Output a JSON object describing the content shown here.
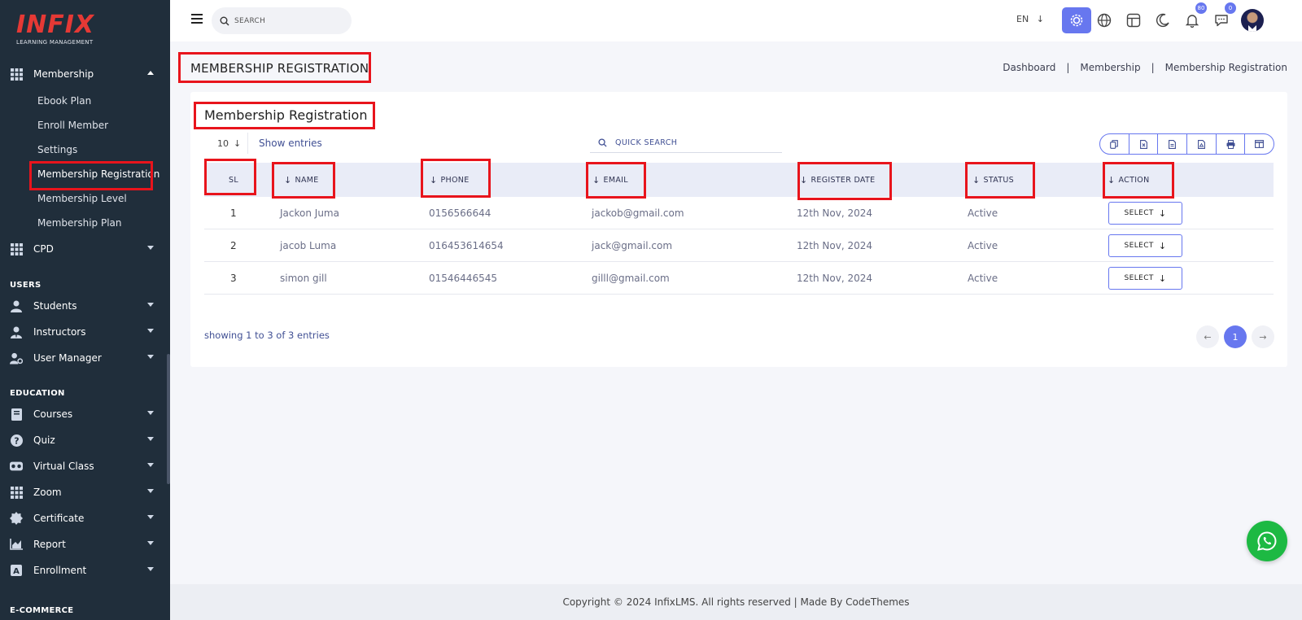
{
  "app": {
    "logo_text": "INFIX",
    "logo_sub": "LEARNING MANAGEMENT"
  },
  "sidebar": {
    "membership": {
      "label": "Membership",
      "sub_items": [
        {
          "label": "Ebook Plan"
        },
        {
          "label": "Enroll Member"
        },
        {
          "label": "Settings"
        },
        {
          "label": "Membership Registration"
        },
        {
          "label": "Membership Level"
        },
        {
          "label": "Membership Plan"
        }
      ]
    },
    "cpd": {
      "label": "CPD"
    },
    "users_section": "USERS",
    "students": {
      "label": "Students"
    },
    "instructors": {
      "label": "Instructors"
    },
    "user_manager": {
      "label": "User Manager"
    },
    "education_section": "EDUCATION",
    "courses": {
      "label": "Courses"
    },
    "quiz": {
      "label": "Quiz"
    },
    "virtual_class": {
      "label": "Virtual Class"
    },
    "zoom": {
      "label": "Zoom"
    },
    "certificate": {
      "label": "Certificate"
    },
    "report": {
      "label": "Report"
    },
    "enrollment": {
      "label": "Enrollment"
    },
    "ecommerce_section": "E-COMMERCE"
  },
  "topbar": {
    "search_placeholder": "SEARCH",
    "language": "EN",
    "notifications_count": "80",
    "messages_count": "0"
  },
  "page": {
    "title": "MEMBERSHIP REGISTRATION",
    "breadcrumb": [
      "Dashboard",
      "Membership",
      "Membership Registration"
    ]
  },
  "card": {
    "title": "Membership Registration",
    "page_length": "10",
    "show_entries": "Show entries",
    "quick_search": "QUICK SEARCH",
    "columns": [
      "SL",
      "NAME",
      "PHONE",
      "EMAIL",
      "REGISTER DATE",
      "STATUS",
      "ACTION"
    ],
    "rows": [
      {
        "sl": "1",
        "name": "Jackon Juma",
        "phone": "0156566644",
        "email": "jackob@gmail.com",
        "date": "12th Nov, 2024",
        "status": "Active",
        "action": "SELECT"
      },
      {
        "sl": "2",
        "name": "jacob Luma",
        "phone": "016453614654",
        "email": "jack@gmail.com",
        "date": "12th Nov, 2024",
        "status": "Active",
        "action": "SELECT"
      },
      {
        "sl": "3",
        "name": "simon gill",
        "phone": "01546446545",
        "email": "gilll@gmail.com",
        "date": "12th Nov, 2024",
        "status": "Active",
        "action": "SELECT"
      }
    ],
    "showing": "showing 1 to 3 of 3 entries",
    "current_page": "1"
  },
  "footer": {
    "text": "Copyright © 2024 InfixLMS. All rights reserved | Made By CodeThemes"
  },
  "colors": {
    "sidebar_bg": "#202e3b",
    "accent": "#6777ef",
    "highlight": "#e8141c",
    "whatsapp": "#1db943"
  }
}
